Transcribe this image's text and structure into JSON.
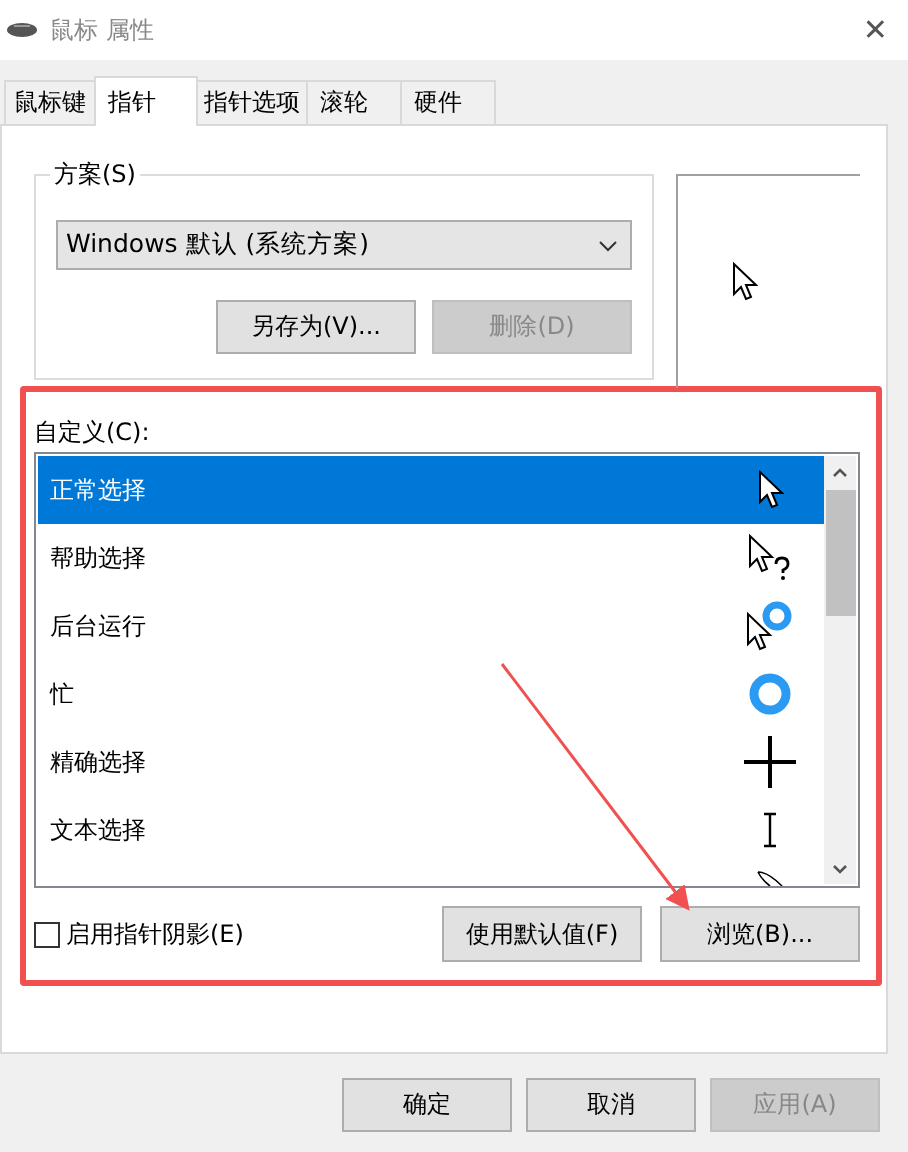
{
  "window": {
    "title": "鼠标 属性",
    "close": "✕"
  },
  "tabs": [
    {
      "label": "鼠标键",
      "selected": false
    },
    {
      "label": "指针",
      "selected": true
    },
    {
      "label": "指针选项",
      "selected": false
    },
    {
      "label": "滚轮",
      "selected": false
    },
    {
      "label": "硬件",
      "selected": false
    }
  ],
  "scheme": {
    "label": "方案(S)",
    "value": "Windows 默认 (系统方案)",
    "buttons": [
      {
        "label": "另存为(V)...",
        "disabled": false
      },
      {
        "label": "删除(D)",
        "disabled": true
      }
    ]
  },
  "customize": {
    "label": "自定义(C):",
    "rows": [
      {
        "label": "正常选择",
        "kind": "arrow",
        "selected": true
      },
      {
        "label": "帮助选择",
        "kind": "help",
        "selected": false
      },
      {
        "label": "后台运行",
        "kind": "working",
        "selected": false
      },
      {
        "label": "忙",
        "kind": "busy",
        "selected": false
      },
      {
        "label": "精确选择",
        "kind": "precision",
        "selected": false
      },
      {
        "label": "文本选择",
        "kind": "text",
        "selected": false
      },
      {
        "kind": "handwriting",
        "selected": false
      }
    ]
  },
  "shadow": {
    "label": "启用指针阴影(E)",
    "checked": false
  },
  "list_buttons": [
    "使用默认值(F)",
    "浏览(B)..."
  ],
  "dialog_buttons": [
    {
      "label": "确定",
      "disabled": false
    },
    {
      "label": "取消",
      "disabled": false
    },
    {
      "label": "应用(A)",
      "disabled": true
    }
  ]
}
